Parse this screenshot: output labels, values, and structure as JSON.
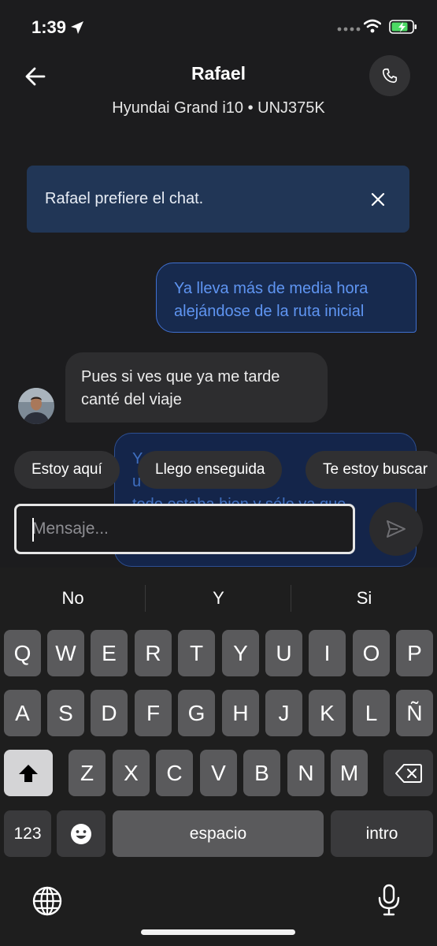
{
  "status_bar": {
    "time": "1:39"
  },
  "header": {
    "contact_name": "Rafael",
    "vehicle": "Hyundai Grand i10 • UNJ375K"
  },
  "banner": {
    "text": "Rafael prefiere el chat."
  },
  "messages": {
    "outgoing_1": [
      "Ya lleva más de media hora",
      "alejándose de la ruta inicial"
    ],
    "incoming_1": [
      "Pues si ves que ya me tarde",
      "canté del viaje"
    ],
    "outgoing_2": [
      "Y",
      "u",
      "todo estaba bien y sólo ya que"
    ]
  },
  "quick_replies": [
    "Estoy aquí",
    "Llego enseguida",
    "Te estoy buscar"
  ],
  "composer": {
    "placeholder": "Mensaje..."
  },
  "keyboard": {
    "suggestions": [
      "No",
      "Y",
      "Si"
    ],
    "row1": [
      "Q",
      "W",
      "E",
      "R",
      "T",
      "Y",
      "U",
      "I",
      "O",
      "P"
    ],
    "row2": [
      "A",
      "S",
      "D",
      "F",
      "G",
      "H",
      "J",
      "K",
      "L",
      "Ñ"
    ],
    "row3": [
      "Z",
      "X",
      "C",
      "V",
      "B",
      "N",
      "M"
    ],
    "numbers_label": "123",
    "space_label": "espacio",
    "return_label": "intro"
  },
  "colors": {
    "accent": "#5f95f2",
    "banner": "#213656",
    "background": "#1c1c1e"
  },
  "icons": [
    "location-arrow-icon",
    "wifi-icon",
    "battery-icon",
    "back-arrow-icon",
    "phone-icon",
    "close-icon",
    "send-icon",
    "shift-icon",
    "backspace-icon",
    "emoji-icon",
    "globe-icon",
    "microphone-icon"
  ]
}
